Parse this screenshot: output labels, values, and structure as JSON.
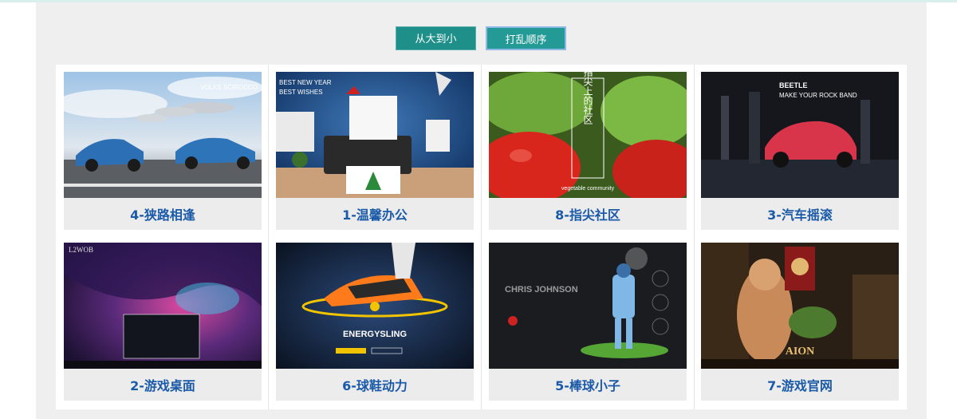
{
  "controls": {
    "sort_label": "从大到小",
    "shuffle_label": "打乱顺序"
  },
  "cards": [
    {
      "label": "4-狭路相逢",
      "art": {
        "title": "VOLKS SCIROCCO"
      }
    },
    {
      "label": "1-温馨办公",
      "art": {
        "title": "BEST NEW YEAR",
        "subtitle": "BEST WISHES"
      }
    },
    {
      "label": "8-指尖社区",
      "art": {
        "title": "指尖上的社区",
        "subtitle": "vegetable community"
      }
    },
    {
      "label": "3-汽车摇滚",
      "art": {
        "title": "BEETLE",
        "subtitle": "MAKE YOUR ROCK BAND"
      }
    },
    {
      "label": "2-游戏桌面",
      "art": {
        "title": "L2WOB"
      }
    },
    {
      "label": "6-球鞋动力",
      "art": {
        "title": "ENERGYSLING"
      }
    },
    {
      "label": "5-棒球小子",
      "art": {
        "title": "CHRIS JOHNSON"
      }
    },
    {
      "label": "7-游戏官网",
      "art": {
        "title": "AION"
      }
    }
  ],
  "colors": {
    "accent": "#1f8f8a",
    "caption_text": "#1a5aa8",
    "caption_bg": "#ececec",
    "panel_bg": "#efefef"
  }
}
